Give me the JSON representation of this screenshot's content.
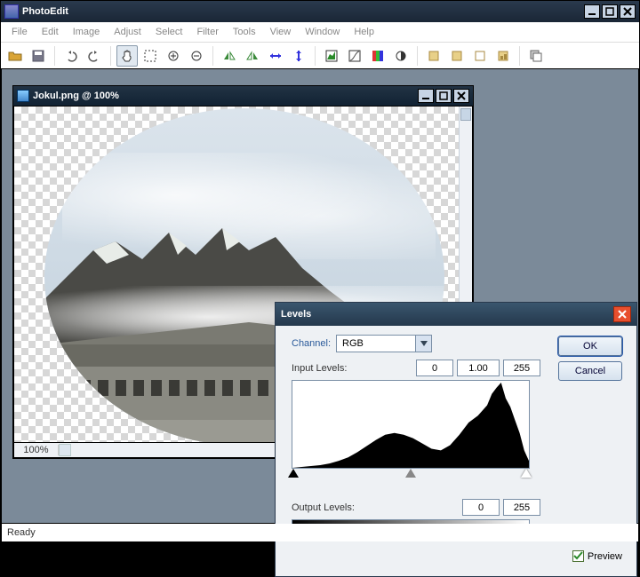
{
  "app": {
    "title": "PhotoEdit"
  },
  "menu": {
    "items": [
      "File",
      "Edit",
      "Image",
      "Adjust",
      "Select",
      "Filter",
      "Tools",
      "View",
      "Window",
      "Help"
    ]
  },
  "document": {
    "title": "Jokul.png @ 100%",
    "zoom": "100%"
  },
  "status": {
    "text": "Ready"
  },
  "dialog": {
    "title": "Levels",
    "channel_label": "Channel:",
    "channel_value": "RGB",
    "input_label": "Input Levels:",
    "input_low": "0",
    "input_mid": "1.00",
    "input_high": "255",
    "output_label": "Output Levels:",
    "output_low": "0",
    "output_high": "255",
    "ok": "OK",
    "cancel": "Cancel",
    "preview": "Preview"
  },
  "chart_data": {
    "type": "area",
    "title": "Input Levels",
    "xlabel": "",
    "ylabel": "",
    "xlim": [
      0,
      255
    ],
    "ylim": [
      0,
      100
    ],
    "x": [
      0,
      10,
      20,
      30,
      40,
      50,
      60,
      70,
      80,
      90,
      100,
      110,
      120,
      130,
      140,
      150,
      160,
      170,
      180,
      190,
      200,
      210,
      215,
      220,
      225,
      230,
      235,
      240,
      245,
      250,
      255
    ],
    "values": [
      0,
      1,
      2,
      3,
      5,
      8,
      12,
      18,
      25,
      32,
      38,
      40,
      38,
      34,
      28,
      22,
      20,
      26,
      38,
      52,
      60,
      72,
      85,
      92,
      98,
      80,
      70,
      55,
      40,
      20,
      8
    ]
  }
}
